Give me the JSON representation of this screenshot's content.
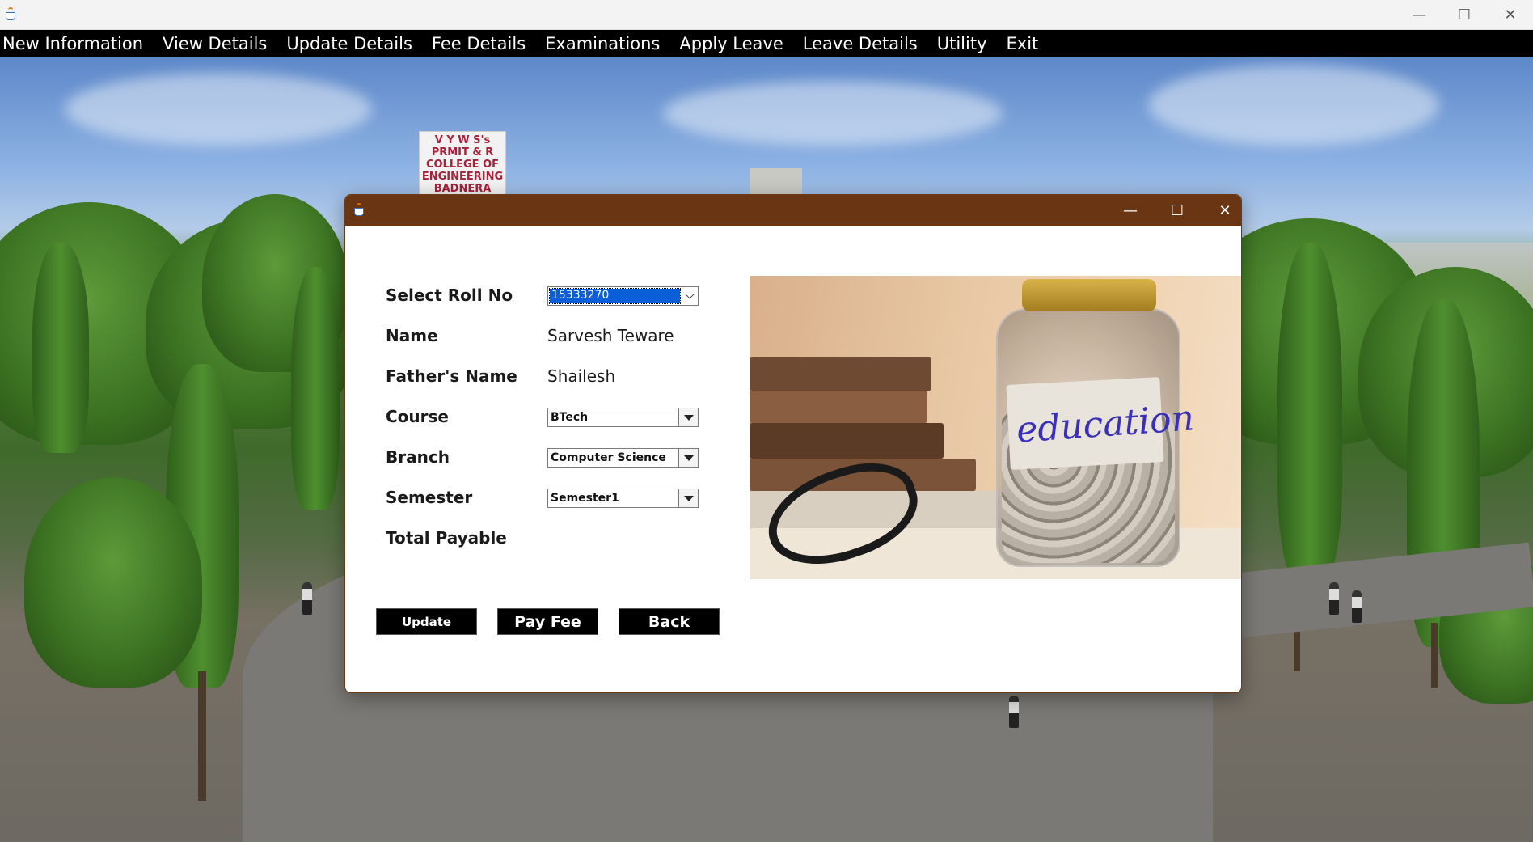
{
  "window": {
    "icon": "java-cup-icon",
    "controls": {
      "minimize": "—",
      "maximize": "☐",
      "close": "✕"
    }
  },
  "menubar": {
    "items": [
      "New Information",
      "View Details",
      "Update Details",
      "Fee Details",
      "Examinations",
      "Apply Leave",
      "Leave Details",
      "Utility",
      "Exit"
    ]
  },
  "background": {
    "sign_lines": [
      "V Y W S's",
      "PRMIT & R",
      "COLLEGE OF",
      "ENGINEERING",
      "BADNERA"
    ]
  },
  "dialog": {
    "icon": "java-cup-icon",
    "title_color": "#6a3512",
    "controls": {
      "minimize": "—",
      "maximize": "☐",
      "close": "✕"
    },
    "form": {
      "roll_label": "Select Roll No",
      "roll_value": "15333270",
      "name_label": "Name",
      "name_value": "Sarvesh Teware",
      "father_label": "Father's Name",
      "father_value": "Shailesh",
      "course_label": "Course",
      "course_value": "BTech",
      "branch_label": "Branch",
      "branch_value": "Computer Science",
      "semester_label": "Semester",
      "semester_value": "Semester1",
      "total_label": "Total Payable"
    },
    "buttons": {
      "update": "Update",
      "pay_fee": "Pay Fee",
      "back": "Back"
    },
    "photo": {
      "jar_label": "education"
    }
  }
}
